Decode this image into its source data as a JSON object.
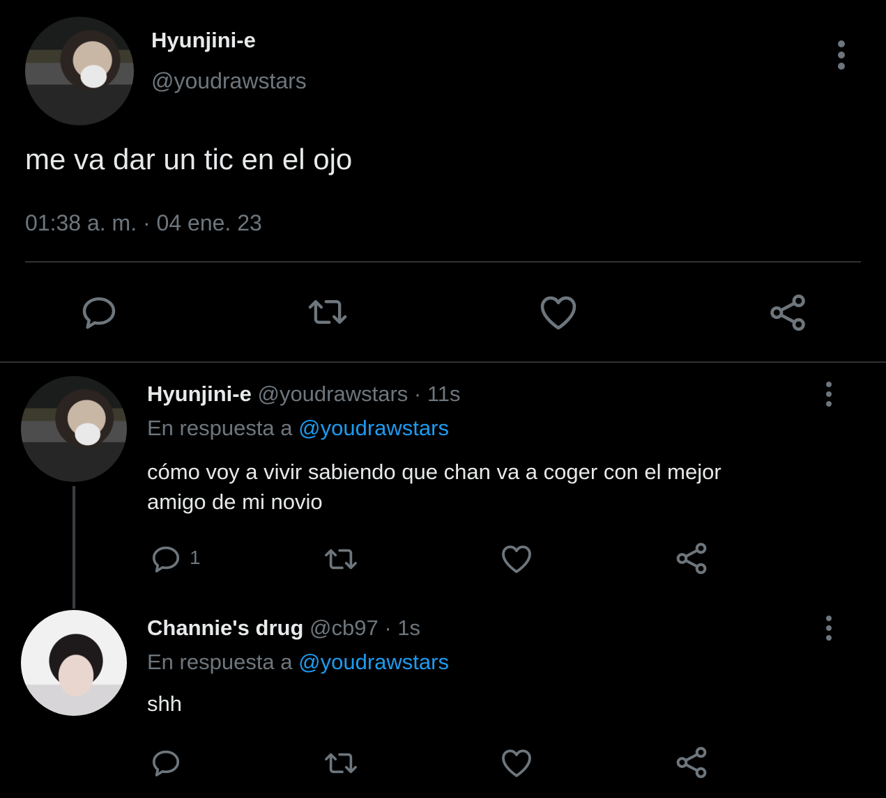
{
  "main_tweet": {
    "display_name": "Hyunjini-e",
    "handle": "@youdrawstars",
    "text": "me va dar un tic en el ojo",
    "timestamp": "01:38 a. m. · 04 ene. 23"
  },
  "replies": [
    {
      "display_name": "Hyunjini-e",
      "handle": "@youdrawstars",
      "time": " · 11s",
      "reply_prefix": "En respuesta a",
      "reply_to": "@youdrawstars",
      "text_line1": "cómo voy a vivir sabiendo que chan va a coger con el mejor",
      "text_line2": "amigo de mi novio",
      "reply_count": "1"
    },
    {
      "display_name": "Channie's drug",
      "handle": "@cb97",
      "time": " · 1s",
      "reply_prefix": "En respuesta a",
      "reply_to": "@youdrawstars",
      "text_line1": "shh"
    }
  ],
  "icons": {
    "reply": "reply-icon",
    "retweet": "retweet-icon",
    "like": "heart-icon",
    "share": "share-icon",
    "more": "more-vertical-icon"
  },
  "colors": {
    "background": "#000000",
    "text": "#e7e9ea",
    "muted": "#6e767d",
    "link": "#1d9bf0",
    "divider": "#2f3336"
  }
}
